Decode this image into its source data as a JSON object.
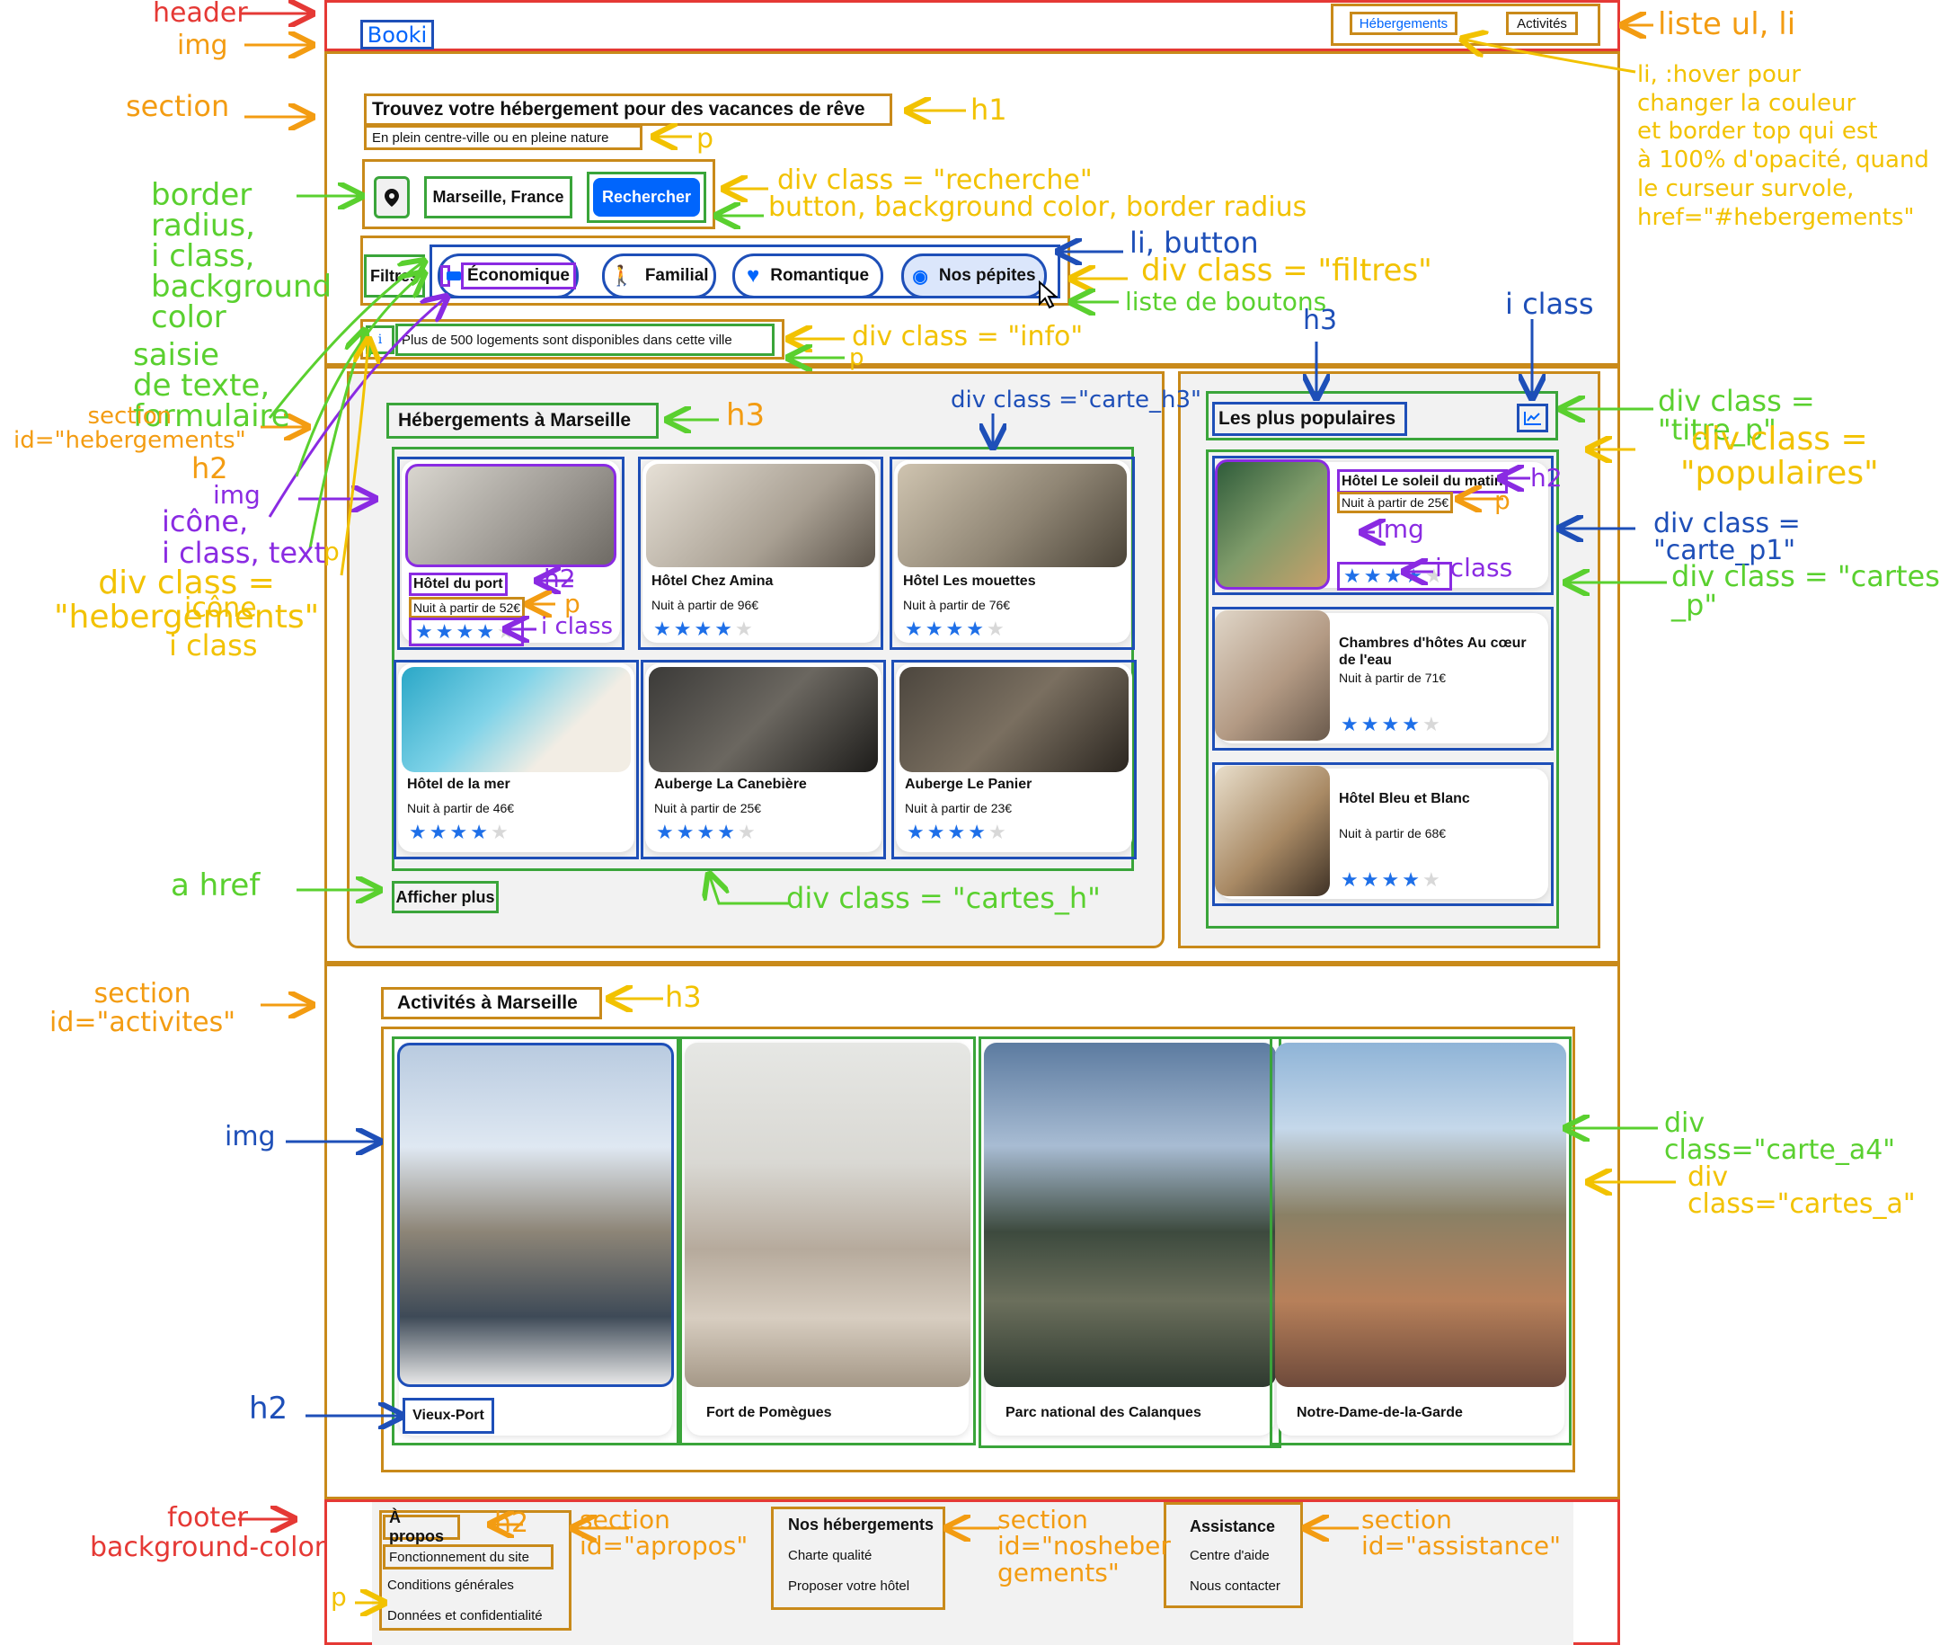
{
  "header": {
    "logo": "Booki",
    "nav": [
      "Hébergements",
      "Activités"
    ]
  },
  "hero": {
    "title": "Trouvez votre hébergement pour des vacances de rêve",
    "subtitle": "En plein centre-ville ou en pleine nature",
    "search_value": "Marseille, France",
    "search_button": "Rechercher"
  },
  "filters": {
    "label": "Filtres",
    "items": [
      "Économique",
      "Familial",
      "Romantique",
      "Nos pépites"
    ]
  },
  "info": "Plus de 500 logements sont disponibles dans cette ville",
  "hebergements": {
    "title": "Hébergements à Marseille",
    "cards": [
      {
        "name": "Hôtel du port",
        "price": "Nuit à partir de 52€",
        "rating": 4
      },
      {
        "name": "Hôtel Chez Amina",
        "price": "Nuit à partir de 96€",
        "rating": 4
      },
      {
        "name": "Hôtel Les mouettes",
        "price": "Nuit à partir de 76€",
        "rating": 4
      },
      {
        "name": "Hôtel de la mer",
        "price": "Nuit à partir de 46€",
        "rating": 4
      },
      {
        "name": "Auberge La Canebière",
        "price": "Nuit à partir de 25€",
        "rating": 4
      },
      {
        "name": "Auberge Le Panier",
        "price": "Nuit à partir de 23€",
        "rating": 4
      }
    ],
    "more": "Afficher plus"
  },
  "populaires": {
    "title": "Les plus populaires",
    "cards": [
      {
        "name": "Hôtel Le soleil du matin",
        "price": "Nuit à partir de 25€",
        "rating": 4
      },
      {
        "name": "Chambres d'hôtes Au cœur de l'eau",
        "price": "Nuit à partir de 71€",
        "rating": 4
      },
      {
        "name": "Hôtel Bleu et Blanc",
        "price": "Nuit à partir de 68€",
        "rating": 4
      }
    ]
  },
  "activites": {
    "title": "Activités à Marseille",
    "cards": [
      "Vieux-Port",
      "Fort de Pomègues",
      "Parc national des Calanques",
      "Notre-Dame-de-la-Garde"
    ]
  },
  "footer": {
    "apropos": {
      "title": "À propos",
      "links": [
        "Fonctionnement du site",
        "Conditions générales",
        "Données et confidentialité"
      ]
    },
    "nosheb": {
      "title": "Nos hébergements",
      "links": [
        "Charte qualité",
        "Proposer votre hôtel"
      ]
    },
    "assistance": {
      "title": "Assistance",
      "links": [
        "Centre d'aide",
        "Nous contacter"
      ]
    }
  },
  "annotations": {
    "header": "header",
    "img": "img",
    "section": "section",
    "liste": "liste ul, li",
    "hover": "li, :hover pour\nchanger la couleur\net border top qui est\nà 100% d'opacité, quand\nle curseur survole,\nhref=\"#hebergements\"",
    "h1": "h1",
    "p": "p",
    "recherche": "div class = \"recherche\"",
    "button": "button, background color, border radius",
    "border_radius": "border\nradius,\ni class,\nbackground\ncolor",
    "li_button": "li, button",
    "filtres": "div class = \"filtres\"",
    "liste_boutons": "liste de boutons",
    "saisie": "saisie\nde texte,\nformulaire",
    "info": "div class = \"info\"",
    "p2": "p",
    "h3_top": "h3",
    "iclass_top": "i class",
    "section_id_heb": "section\nid=\"hebergements\"",
    "h2_left": "h2",
    "img_left": "img",
    "icone_left": "icône,\ni class, text",
    "p_left": "p",
    "div_heb": "div class =\n\"hebergements\"",
    "icone2": "icône",
    "iclass_left": "i class",
    "h3_heb": "h3",
    "carte_h3": "div class =\"carte_h3\"",
    "titre_p": "div class = \"titre_p\"",
    "populaires_div": "div class =\n\"populaires\"",
    "h2_card": "h2",
    "p_card": "p",
    "img_card": "img",
    "iclass_card": "i class",
    "h2_pop": "h2",
    "p_pop": "p",
    "img_pop": "img",
    "iclass_pop": "i class",
    "carte_p1": "div class = \"carte_p1\"",
    "cartes_p": "div class = \"cartes\n_p\"",
    "a_href": "a href",
    "cartes_h": "div class = \"cartes_h\"",
    "section_act": "section\nid=\"activites\"",
    "h3_act": "h3",
    "img_act": "img",
    "carte_a4": "div class=\"carte_a4\"",
    "cartes_a": "div class=\"cartes_a\"",
    "h2_act": "h2",
    "footer": "footer\nbackground-color",
    "h2_foot": "h2",
    "section_apropos": "section\nid=\"apropos\"",
    "section_nosheb": "section\nid=\"nosheber\ngements\"",
    "section_assist": "section\nid=\"assistance\"",
    "p_foot": "p"
  },
  "colors": {
    "primary": "#0065fc",
    "annotation_red": "#e53935",
    "annotation_orange": "#f39c12",
    "annotation_green": "#5ad02f",
    "annotation_blue": "#1e4fb8",
    "annotation_purple": "#8a2be2"
  }
}
